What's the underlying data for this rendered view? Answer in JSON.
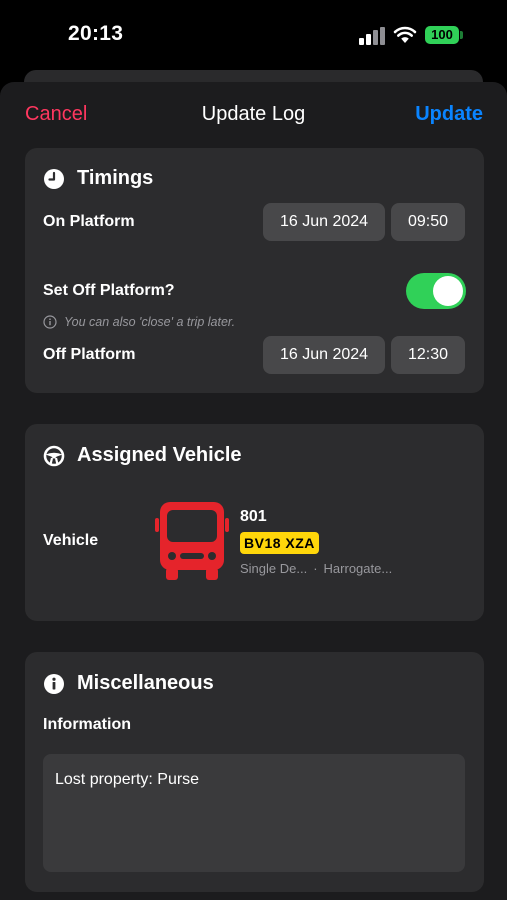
{
  "status_bar": {
    "time": "20:13",
    "battery": "100",
    "battery_color": "#30d158"
  },
  "nav": {
    "cancel_label": "Cancel",
    "title": "Update Log",
    "update_label": "Update",
    "cancel_color": "#ff375f",
    "update_color": "#0a84ff"
  },
  "timings": {
    "title": "Timings",
    "icon": "clock-icon",
    "on_platform": {
      "label": "On Platform",
      "date": "16 Jun 2024",
      "time": "09:50"
    },
    "set_off_platform": {
      "label": "Set Off Platform?",
      "enabled": true
    },
    "hint": "You can also 'close' a trip later.",
    "off_platform": {
      "label": "Off Platform",
      "date": "16 Jun 2024",
      "time": "12:30"
    }
  },
  "vehicle": {
    "title": "Assigned Vehicle",
    "icon": "steering-wheel-icon",
    "label": "Vehicle",
    "number": "801",
    "plate": "BV18 XZA",
    "type": "Single De...",
    "depot": "Harrogate...",
    "bus_color": "#e5242b",
    "plate_color": "#ffd60a"
  },
  "misc": {
    "title": "Miscellaneous",
    "icon": "info-icon",
    "info_label": "Information",
    "info_value": "Lost property: Purse"
  }
}
